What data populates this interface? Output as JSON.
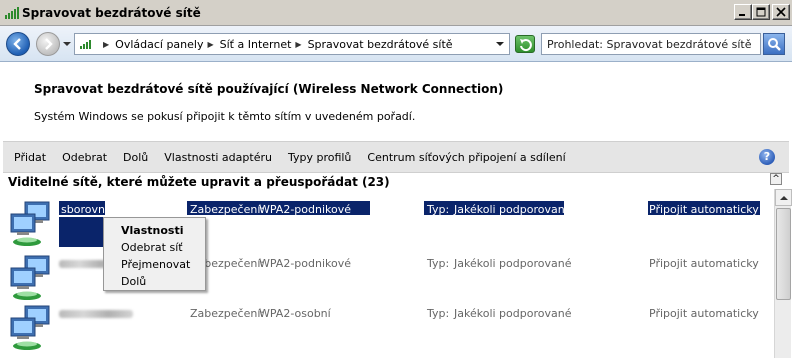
{
  "window": {
    "title": "Spravovat bezdrátové sítě",
    "controls": {
      "minimize": "minimize-icon",
      "maximize": "maximize-icon",
      "close": "close-icon"
    }
  },
  "address_bar": {
    "breadcrumbs": [
      "Ovládací panely",
      "Síť a Internet",
      "Spravovat bezdrátové sítě"
    ],
    "search_placeholder": "Prohledat: Spravovat bezdrátové sítě"
  },
  "header": {
    "title": "Spravovat bezdrátové sítě používající (Wireless Network Connection)",
    "subtitle": "Systém Windows se pokusí připojit k těmto sítím v uvedeném pořadí."
  },
  "toolbar": {
    "items": [
      "Přidat",
      "Odebrat",
      "Dolů",
      "Vlastnosti adaptéru",
      "Typy profilů",
      "Centrum síťových připojení a sdílení"
    ],
    "help_label": "?"
  },
  "list": {
    "heading": "Viditelné sítě, které můžete upravit a přeuspořádat (23)",
    "security_label": "Zabezpečení:",
    "type_label": "Typ:",
    "rows": [
      {
        "name": "sborovna",
        "security": "WPA2-podnikové",
        "type": "Jakékoli podporované",
        "mode": "Připojit automaticky",
        "selected": true
      },
      {
        "name": "",
        "security": "WPA2-podnikové",
        "type": "Jakékoli podporované",
        "mode": "Připojit automaticky",
        "selected": false
      },
      {
        "name": "",
        "security": "WPA2-osobní",
        "type": "Jakékoli podporované",
        "mode": "Připojit automaticky",
        "selected": false
      }
    ]
  },
  "context_menu": {
    "items": [
      "Vlastnosti",
      "Odebrat síť",
      "Přejmenovat",
      "Dolů"
    ]
  },
  "colors": {
    "selection": "#0a246a",
    "toolbar_bg": "#e5e5e5",
    "address_bg": "#d7e4f2"
  }
}
